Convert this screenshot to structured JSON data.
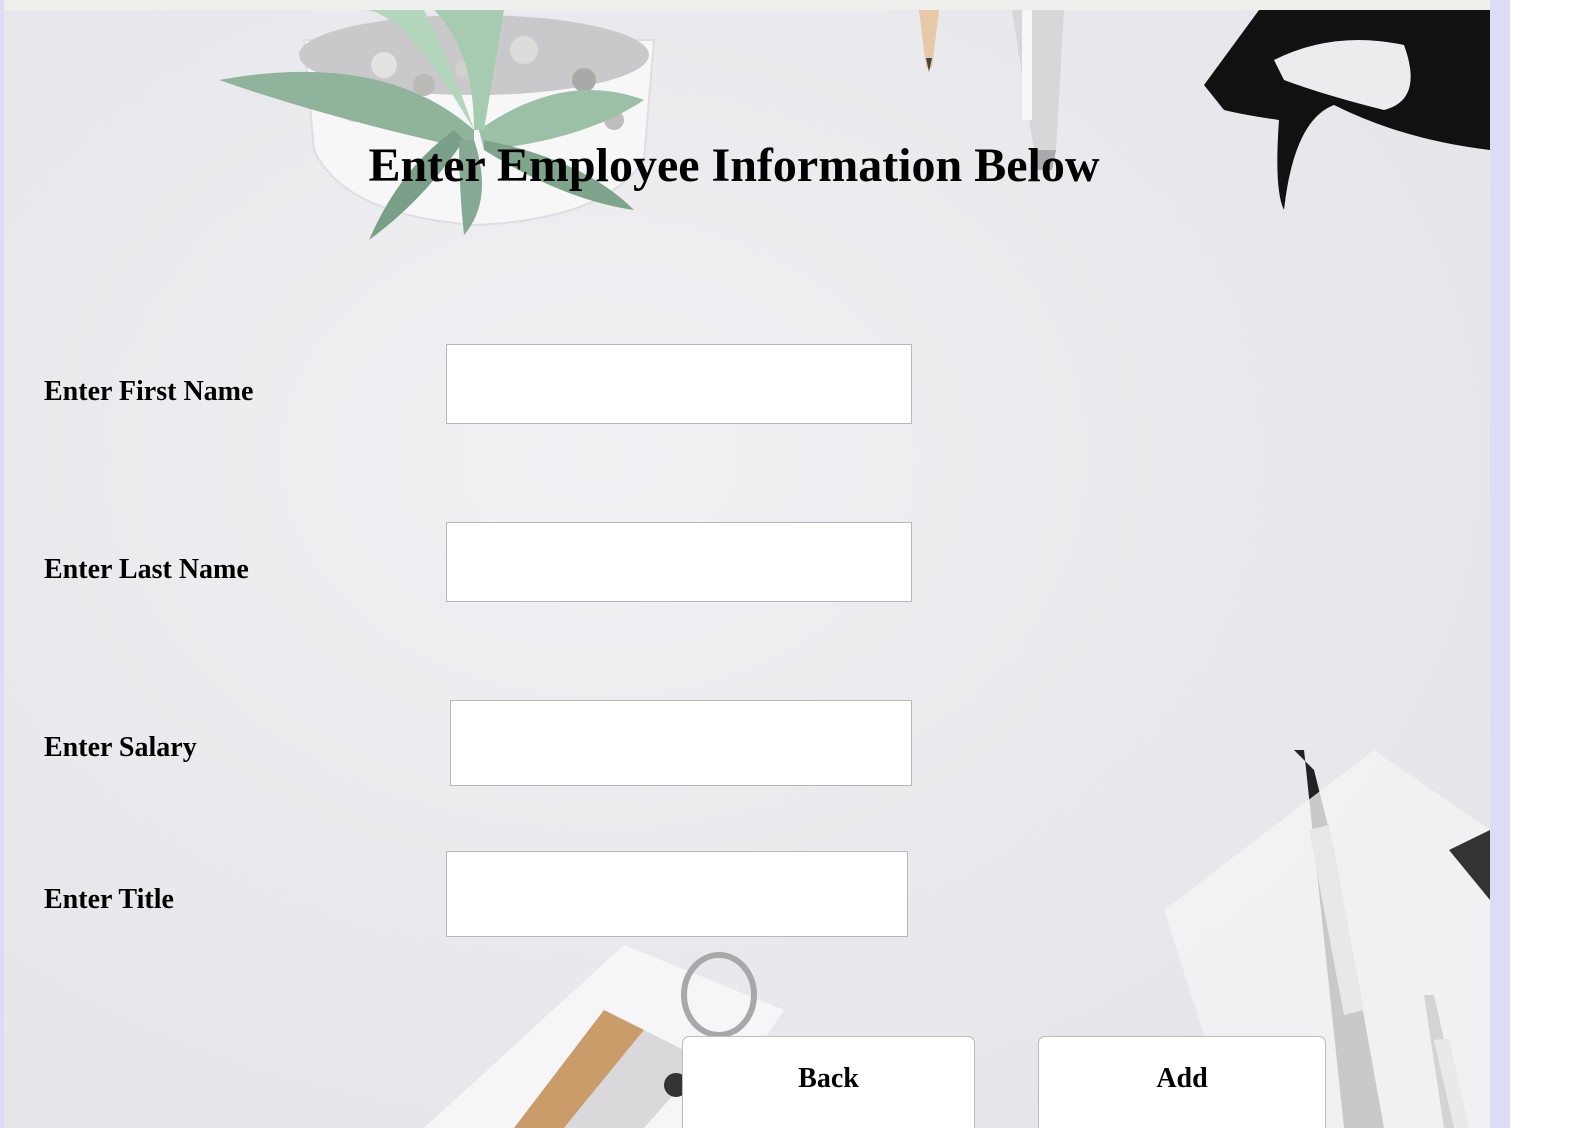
{
  "form": {
    "title": "Enter Employee Information Below",
    "fields": [
      {
        "label": "Enter First Name",
        "value": "",
        "placeholder": ""
      },
      {
        "label": "Enter Last Name",
        "value": "",
        "placeholder": ""
      },
      {
        "label": "Enter Salary",
        "value": "",
        "placeholder": ""
      },
      {
        "label": "Enter Title",
        "value": "",
        "placeholder": ""
      }
    ],
    "buttons": {
      "back_label": "Back",
      "add_label": "Add"
    }
  },
  "colors": {
    "page_frame": "#dcdcf7",
    "background": "#ececee",
    "input_bg": "#ffffff",
    "text": "#000000"
  },
  "background_image": {
    "objects": [
      "succulent-plant",
      "pencil",
      "pen",
      "eyeglasses",
      "mechanical-pencils",
      "ring-binder-cards"
    ]
  }
}
